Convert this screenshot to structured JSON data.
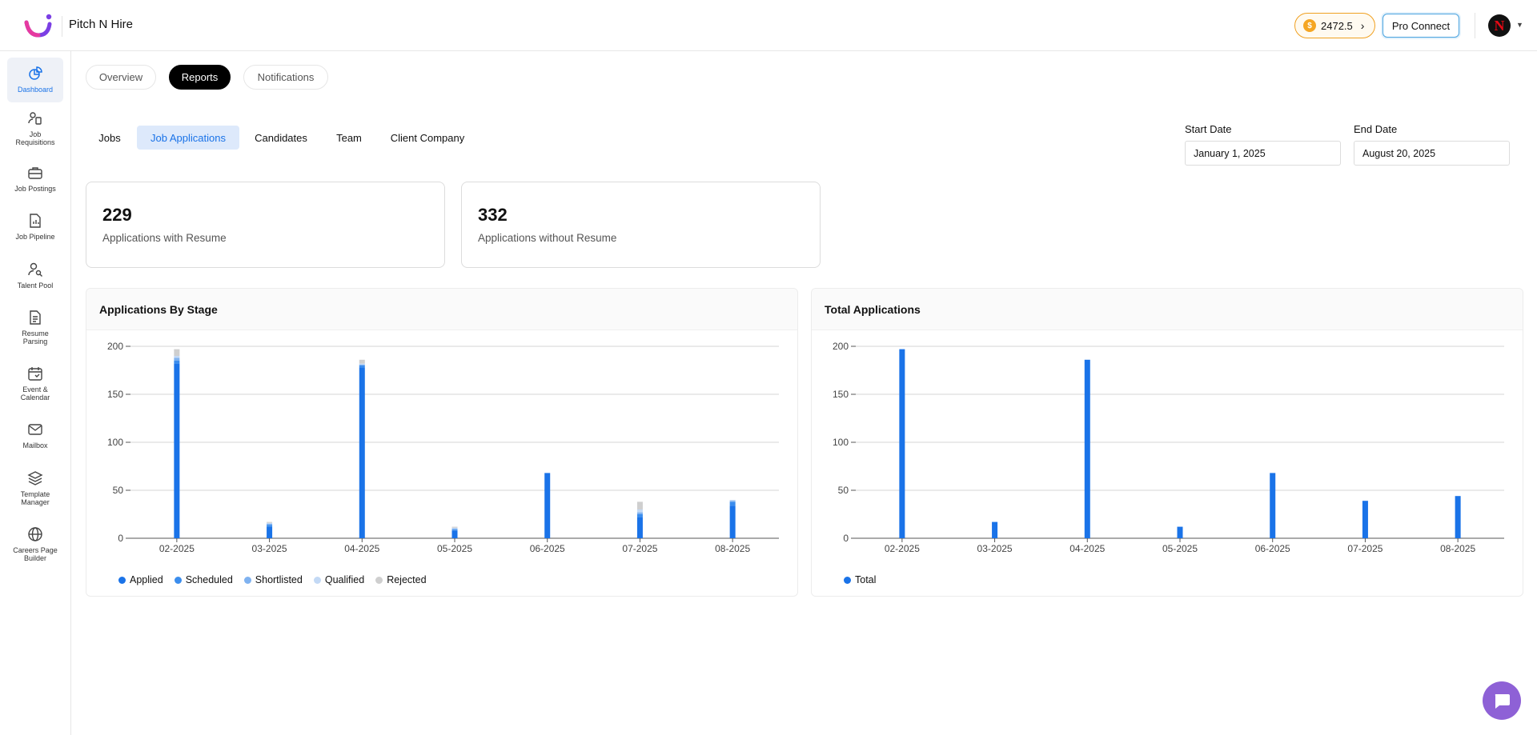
{
  "header": {
    "app_name": "Pitch N Hire",
    "credits": "2472.5",
    "pro_connect_label": "Pro Connect",
    "avatar_letter": "N"
  },
  "sidebar": {
    "items": [
      {
        "label": "Dashboard",
        "icon": "dashboard-icon",
        "active": true
      },
      {
        "label": "Job\nRequisitions",
        "icon": "requisition-icon"
      },
      {
        "label": "Job Postings",
        "icon": "briefcase-icon"
      },
      {
        "label": "Job Pipeline",
        "icon": "pipeline-icon"
      },
      {
        "label": "Talent Pool",
        "icon": "talent-search-icon"
      },
      {
        "label": "Resume\nParsing",
        "icon": "document-icon"
      },
      {
        "label": "Event &\nCalendar",
        "icon": "calendar-icon"
      },
      {
        "label": "Mailbox",
        "icon": "mail-icon"
      },
      {
        "label": "Template\nManager",
        "icon": "layers-icon"
      },
      {
        "label": "Careers Page\nBuilder",
        "icon": "globe-icon"
      }
    ]
  },
  "top_tabs": [
    {
      "label": "Overview"
    },
    {
      "label": "Reports",
      "active": true
    },
    {
      "label": "Notifications"
    }
  ],
  "sub_tabs": [
    {
      "label": "Jobs"
    },
    {
      "label": "Job Applications",
      "active": true
    },
    {
      "label": "Candidates"
    },
    {
      "label": "Team"
    },
    {
      "label": "Client Company"
    }
  ],
  "filters": {
    "start_label": "Start Date",
    "start_value": "January 1, 2025",
    "end_label": "End Date",
    "end_value": "August 20, 2025"
  },
  "stats": [
    {
      "value": "229",
      "label": "Applications with Resume"
    },
    {
      "value": "332",
      "label": "Applications without Resume"
    }
  ],
  "colors": {
    "accent": "#1a73e8",
    "applied": "#1a73e8",
    "scheduled": "#3b8ded",
    "shortlisted": "#7fb2f0",
    "qualified": "#c3d9f5",
    "rejected": "#cfcfcf"
  },
  "chart_data": [
    {
      "type": "bar",
      "stacked": true,
      "title": "Applications By Stage",
      "categories": [
        "02-2025",
        "03-2025",
        "04-2025",
        "05-2025",
        "06-2025",
        "07-2025",
        "08-2025"
      ],
      "ylim": [
        0,
        200
      ],
      "yticks": [
        0,
        50,
        100,
        150,
        200
      ],
      "grid": true,
      "legend_position": "bottom-left",
      "series": [
        {
          "name": "Applied",
          "values": [
            182,
            12,
            178,
            8,
            68,
            22,
            34
          ]
        },
        {
          "name": "Scheduled",
          "values": [
            3,
            2,
            2,
            1,
            0,
            3,
            4
          ]
        },
        {
          "name": "Shortlisted",
          "values": [
            3,
            1,
            1,
            1,
            0,
            2,
            1
          ]
        },
        {
          "name": "Qualified",
          "values": [
            2,
            1,
            1,
            1,
            0,
            3,
            1
          ]
        },
        {
          "name": "Rejected",
          "values": [
            7,
            1,
            4,
            1,
            0,
            8,
            0
          ]
        }
      ]
    },
    {
      "type": "bar",
      "title": "Total Applications",
      "categories": [
        "02-2025",
        "03-2025",
        "04-2025",
        "05-2025",
        "06-2025",
        "07-2025",
        "08-2025"
      ],
      "ylim": [
        0,
        200
      ],
      "yticks": [
        0,
        50,
        100,
        150,
        200
      ],
      "grid": true,
      "legend_position": "bottom-left",
      "series": [
        {
          "name": "Total",
          "values": [
            197,
            17,
            186,
            12,
            68,
            39,
            44
          ]
        }
      ]
    }
  ]
}
